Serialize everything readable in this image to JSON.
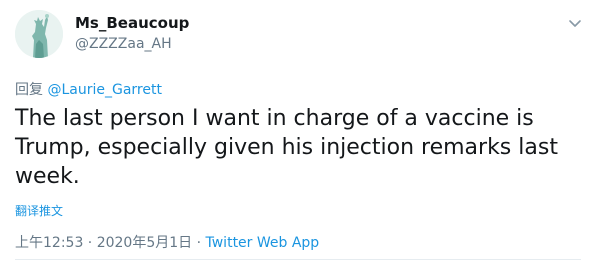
{
  "author": {
    "display_name": "Ms_Beaucoup",
    "handle": "@ZZZZaa_AH",
    "avatar_icon": "statue-of-liberty-avatar"
  },
  "reply": {
    "prefix": "回复",
    "mention": "@Laurie_Garrett"
  },
  "tweet": {
    "text": "The last person I want in charge of a vaccine is Trump, especially given his injection remarks last week."
  },
  "translate_label": "翻译推文",
  "meta": {
    "timestamp": "上午12:53 · 2020年5月1日",
    "separator": " · ",
    "source": "Twitter Web App"
  },
  "icons": {
    "menu": "chevron-down-icon"
  },
  "colors": {
    "link": "#1b95e0",
    "secondary_text": "#657786",
    "primary_text": "#14171a"
  }
}
